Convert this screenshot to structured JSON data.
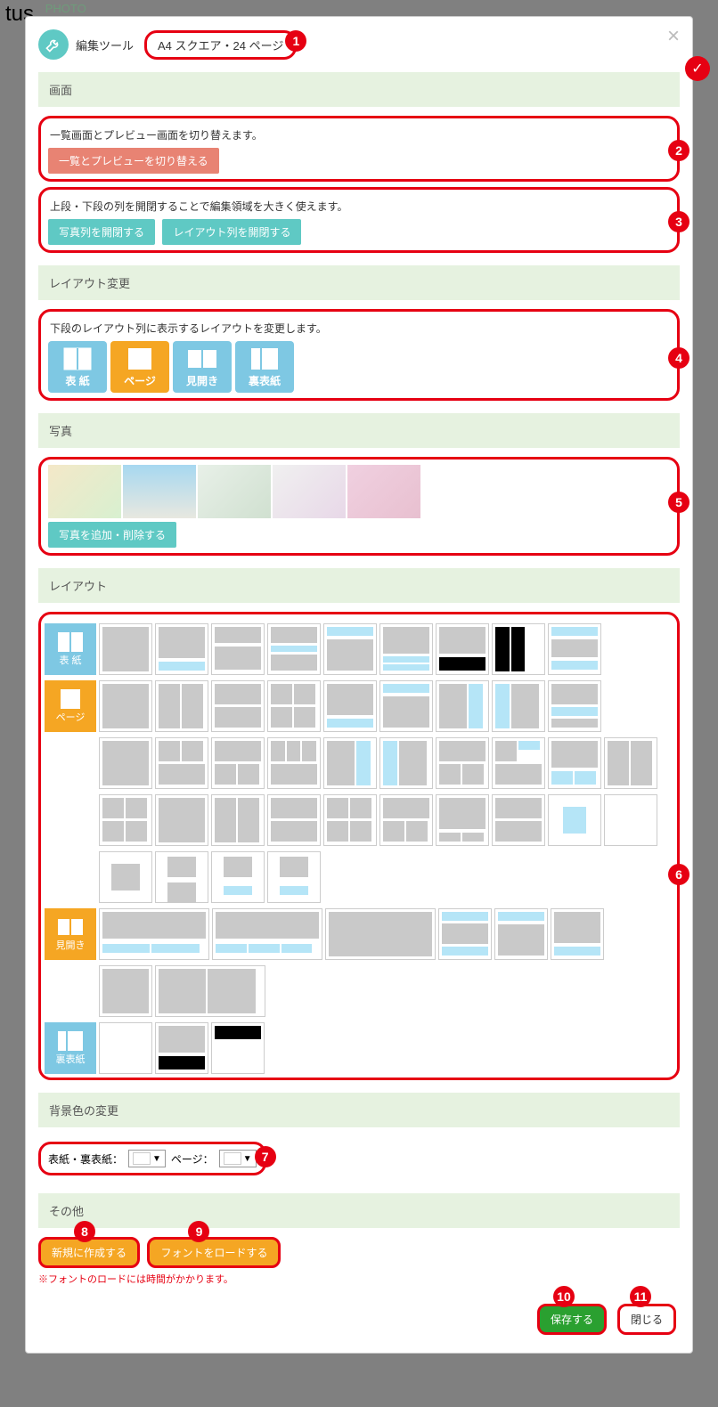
{
  "bg": {
    "tus": "tus",
    "photo": "PHOTO"
  },
  "header": {
    "tool_label": "編集ツール",
    "spec": "A4 スクエア・24 ページ"
  },
  "sections": {
    "screen": "画面",
    "layout_change": "レイアウト変更",
    "photo": "写真",
    "layout": "レイアウト",
    "bgcolor": "背景色の変更",
    "other": "その他"
  },
  "screen": {
    "desc1": "一覧画面とプレビュー画面を切り替えます。",
    "btn1": "一覧とプレビューを切り替える",
    "desc2": "上段・下段の列を開閉することで編集領域を大きく使えます。",
    "btn2a": "写真列を開閉する",
    "btn2b": "レイアウト列を開閉する"
  },
  "layout_change": {
    "desc": "下段のレイアウト列に表示するレイアウトを変更します。",
    "tabs": [
      "表 紙",
      "ページ",
      "見開き",
      "裏表紙"
    ]
  },
  "photo_section": {
    "btn": "写真を追加・削除する"
  },
  "bgcolor": {
    "label1": "表紙・裏表紙：",
    "label2": "ページ："
  },
  "other": {
    "btn1": "新規に作成する",
    "btn2": "フォントをロードする",
    "note": "※フォントのロードには時間がかかります。"
  },
  "footer": {
    "save": "保存する",
    "close": "閉じる"
  },
  "callouts": [
    "1",
    "2",
    "3",
    "4",
    "5",
    "6",
    "7",
    "8",
    "9",
    "10",
    "11"
  ]
}
